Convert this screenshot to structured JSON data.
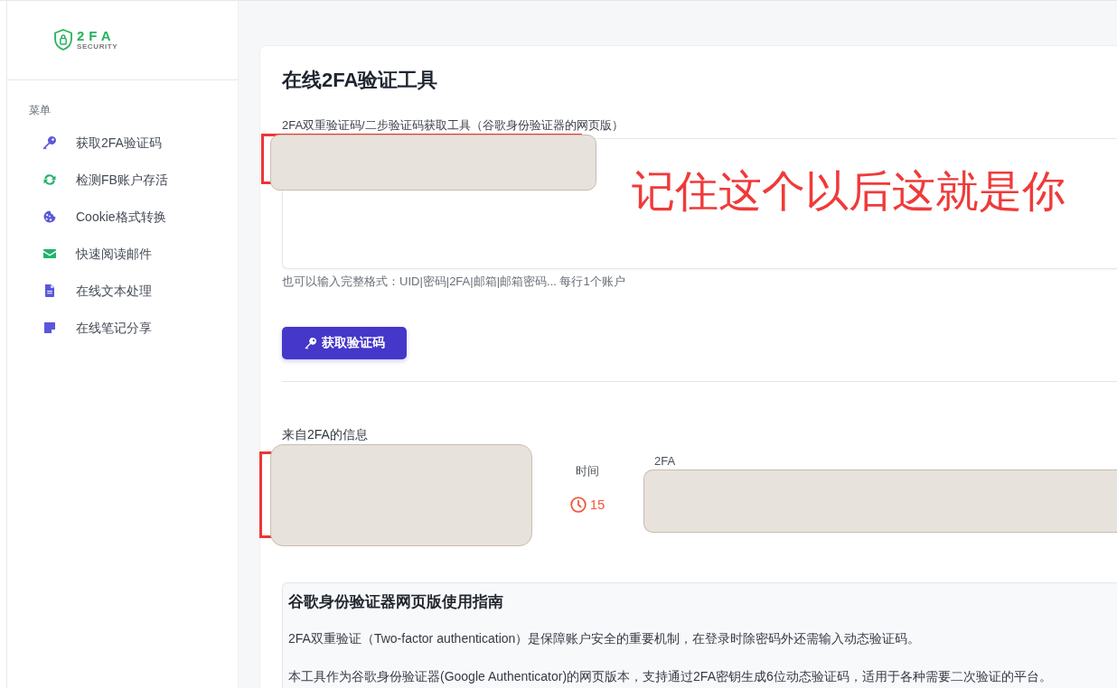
{
  "logo": {
    "title": "2FA",
    "subtitle": "SECURITY"
  },
  "sidebar": {
    "heading": "菜单",
    "items": [
      {
        "label": "获取2FA验证码",
        "kind": "key"
      },
      {
        "label": "检测FB账户存活",
        "kind": "refresh"
      },
      {
        "label": "Cookie格式转换",
        "kind": "cookie"
      },
      {
        "label": "快速阅读邮件",
        "kind": "mail"
      },
      {
        "label": "在线文本处理",
        "kind": "document"
      },
      {
        "label": "在线笔记分享",
        "kind": "note"
      }
    ]
  },
  "main": {
    "title": "在线2FA验证工具",
    "secret_label": "2FA双重验证码/二步验证码获取工具（谷歌身份验证器的网页版）",
    "hint": "也可以输入完整格式：UID|密码|2FA|邮箱|邮箱密码... 每行1个账户",
    "submit_button": "获取验证码"
  },
  "annotation": {
    "text": "记住这个以后这就是你"
  },
  "result": {
    "heading": "来自2FA的信息",
    "time_label": "时间",
    "countdown": "15",
    "code_label": "2FA"
  },
  "guide": {
    "title": "谷歌身份验证器网页版使用指南",
    "paragraphs": [
      "2FA双重验证（Two-factor authentication）是保障账户安全的重要机制，在登录时除密码外还需输入动态验证码。",
      "本工具作为谷歌身份验证器(Google Authenticator)的网页版本，支持通过2FA密钥生成6位动态验证码，适用于各种需要二次验证的平台。"
    ]
  }
}
